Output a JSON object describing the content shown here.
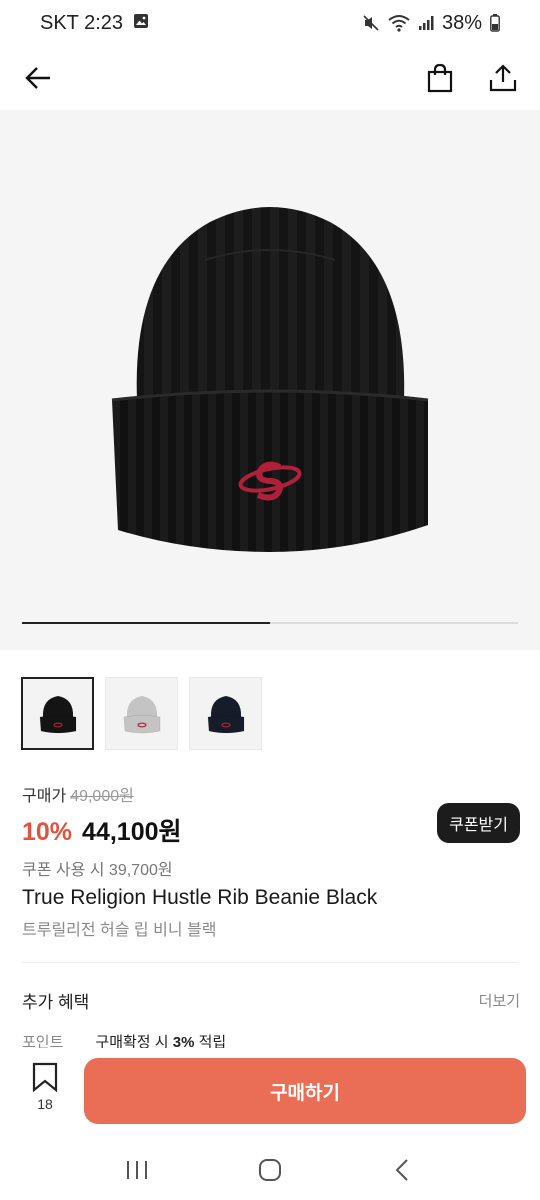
{
  "status_bar": {
    "carrier_time": "SKT 2:23",
    "battery": "38%",
    "icons": [
      "image-icon",
      "mute-icon",
      "wifi-icon",
      "signal-icon",
      "battery-icon"
    ]
  },
  "header": {
    "icons": [
      "back-arrow-icon",
      "shopping-bag-icon",
      "share-icon"
    ]
  },
  "gallery": {
    "progress_fraction": 0.5,
    "thumbnails": [
      {
        "name": "black",
        "color": "#141414",
        "selected": true
      },
      {
        "name": "gray",
        "color": "#c4c4c4",
        "selected": false
      },
      {
        "name": "navy",
        "color": "#161c2a",
        "selected": false
      }
    ]
  },
  "price": {
    "label": "구매가",
    "original": "49,000원",
    "discount": "10%",
    "sale": "44,100원",
    "coupon_note": "쿠폰 사용 시 39,700원",
    "coupon_button": "쿠폰받기"
  },
  "product": {
    "title_en": "True Religion Hustle Rib Beanie Black",
    "title_ko": "트루릴리전 허슬 립 비니 블랙"
  },
  "benefits": {
    "title": "추가 혜택",
    "more": "더보기",
    "point_key": "포인트",
    "point_prefix": "구매확정 시 ",
    "point_rate": "3%",
    "point_suffix": " 적립"
  },
  "bottom": {
    "wishlist_count": "18",
    "buy_label": "구매하기"
  },
  "colors": {
    "accent": "#ea6d55",
    "discount": "#e0533d",
    "logo": "#b0203a"
  }
}
